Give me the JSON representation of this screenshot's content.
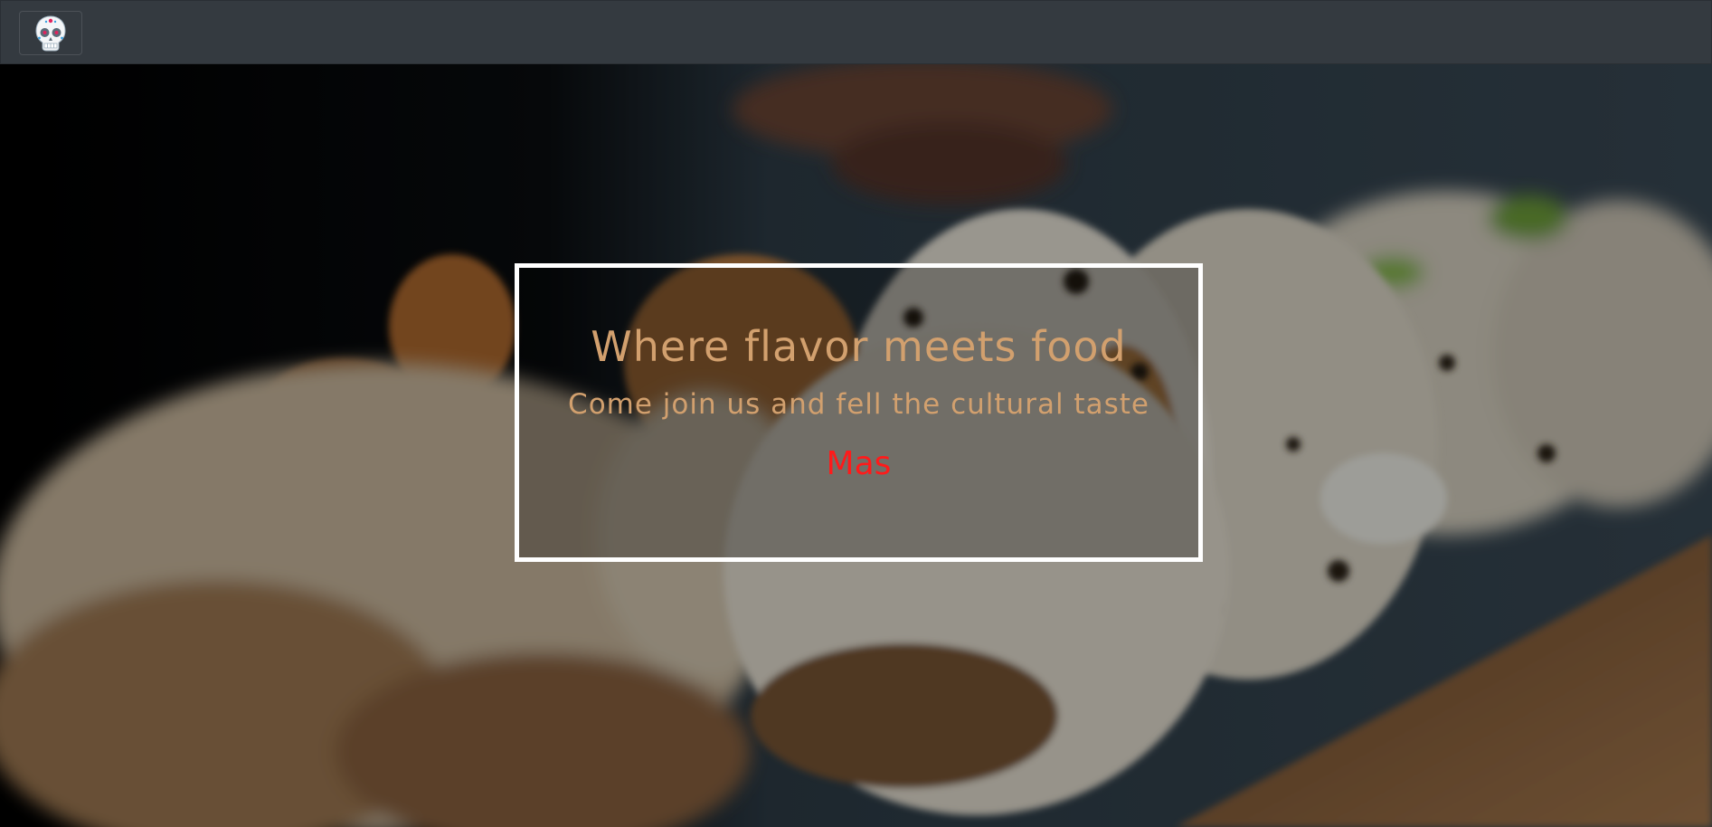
{
  "navbar": {
    "logo_icon": "sugar-skull-icon",
    "background_color": "#343a40"
  },
  "hero": {
    "background_image": "tacos-photo",
    "title": "Where flavor meets food",
    "subtitle": "Come join us and fell the cultural taste",
    "cta_label": "Mas",
    "title_color": "#d2a06e",
    "cta_color": "#ff1a1a",
    "frame_color": "#ffffff"
  }
}
